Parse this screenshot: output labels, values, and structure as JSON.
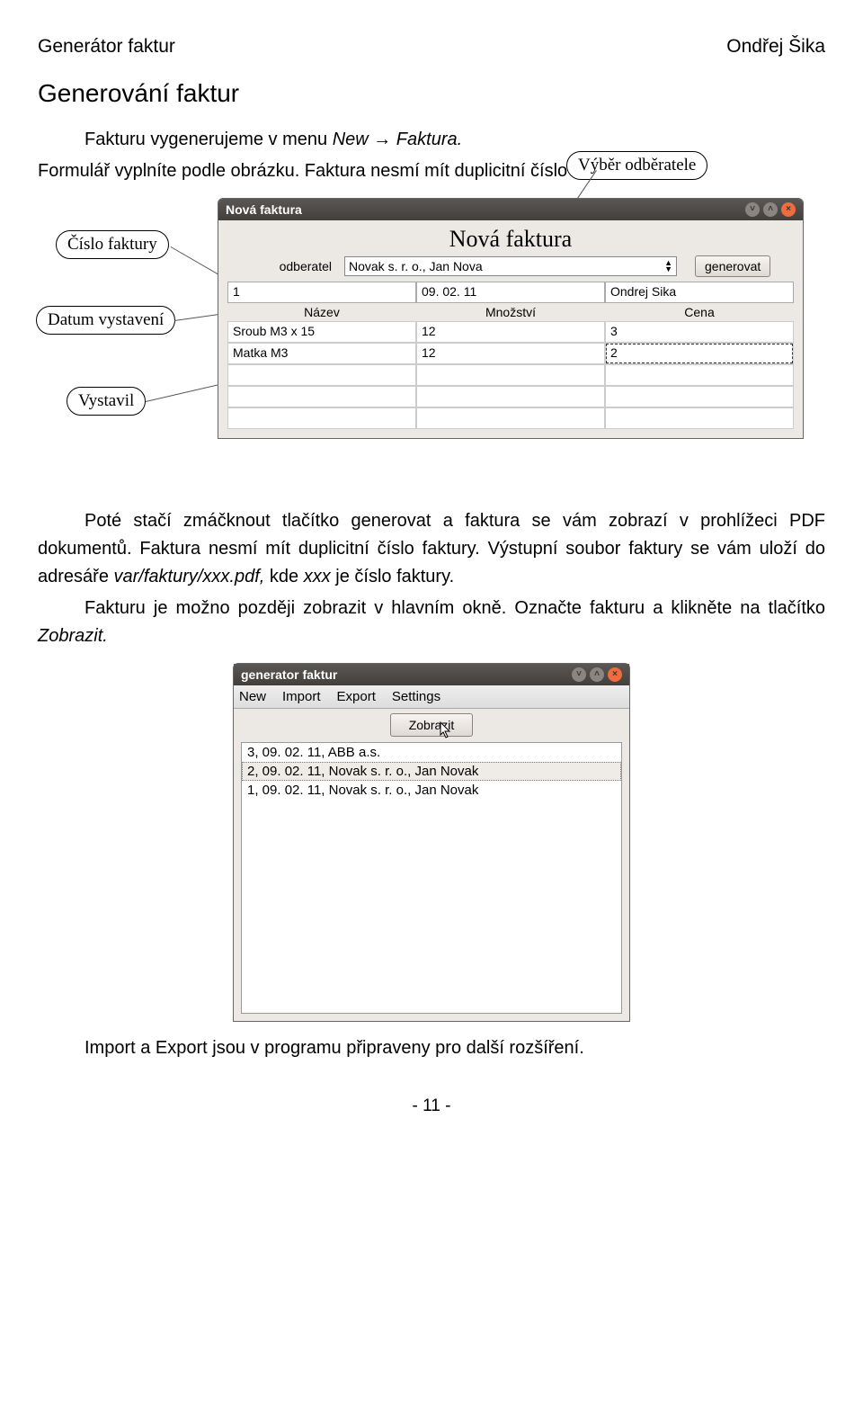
{
  "header": {
    "left": "Generátor faktur",
    "right": "Ondřej Šika"
  },
  "h1": "Generování faktur",
  "p1a": "Fakturu vygenerujeme v menu ",
  "p1b": "New → Faktura.",
  "p2": "Formulář vyplníte podle obrázku. Faktura nesmí mít duplicitní číslo faktury.",
  "callouts": {
    "vyber": "Výběr odběratele",
    "cislo": "Číslo faktury",
    "datum": "Datum vystavení",
    "vystavil": "Vystavil"
  },
  "win1": {
    "title": "Nová faktura",
    "big": "Nová faktura",
    "odberatel_label": "odberatel",
    "odberatel_value": "Novak s. r. o., Jan Nova",
    "generate_btn": "generovat",
    "row2": {
      "a": "1",
      "b": "09. 02. 11",
      "c": "Ondrej Sika"
    },
    "cols": {
      "a": "Název",
      "b": "Množství",
      "c": "Cena"
    },
    "items": [
      {
        "a": "Sroub M3 x 15",
        "b": "12",
        "c": "3"
      },
      {
        "a": "Matka M3",
        "b": "12",
        "c": "2"
      }
    ]
  },
  "p3": "Poté stačí zmáčknout tlačítko generovat a faktura se vám zobrazí v prohlížeci PDF dokumentů. Faktura nesmí mít duplicitní číslo faktury. Výstupní soubor faktury se vám uloží do adresáře ",
  "p3i": "var/faktury/xxx.pdf,",
  "p3b": " kde ",
  "p3i2": "xxx",
  "p3c": " je číslo faktury.",
  "p4a": "Fakturu je možno později zobrazit v hlavním okně. Označte fakturu a klikněte na tlačítko ",
  "p4i": "Zobrazit.",
  "win2": {
    "title": "generator faktur",
    "menu": [
      "New",
      "Import",
      "Export",
      "Settings"
    ],
    "zobrazit": "Zobrazit",
    "rows": [
      "3, 09. 02. 11, ABB a.s.",
      "2, 09. 02. 11, Novak s. r. o., Jan Novak",
      "1, 09. 02. 11, Novak s. r. o., Jan Novak"
    ]
  },
  "p5": "Import a Export jsou v programu připraveny pro další rozšíření.",
  "page": "- 11 -"
}
